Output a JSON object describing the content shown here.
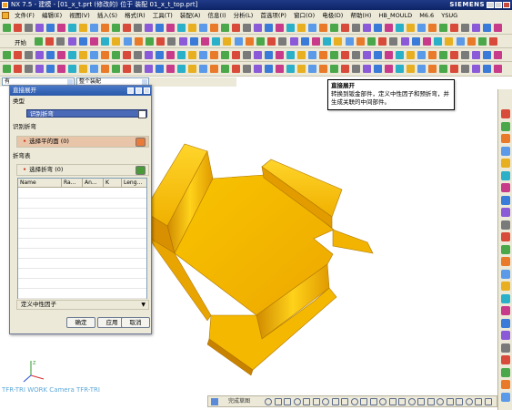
{
  "window": {
    "title": "NX 7.5 - 建模 - [01_x_t.prt (修改的) 位于 装配 01_x_t_top.prt]",
    "brand": "SIEMENS"
  },
  "menu": {
    "items": [
      "文件(F)",
      "编辑(E)",
      "视图(V)",
      "插入(S)",
      "格式(R)",
      "工具(T)",
      "装配(A)",
      "信息(I)",
      "分析(L)",
      "首选项(P)",
      "窗口(O)",
      "电极(D)",
      "帮助(H)",
      "HB_MOULD",
      "M6.6",
      "YSUG"
    ]
  },
  "toolbar": {
    "start_label": "开始",
    "filter_value": "有",
    "scope_value": "整个装配"
  },
  "tooltip": {
    "title": "直接展开",
    "body": "转换到钣金部件，定义中性因子和预折弯，并生成关联的中间部件。"
  },
  "dialog": {
    "title": "直接展开",
    "type_section": "类型",
    "type_value": "识别折弯",
    "identify_section": "识别折弯",
    "select_face": "选择平的面 (0)",
    "bend_table_section": "折弯表",
    "select_bend": "选择折弯 (0)",
    "columns": [
      "Name",
      "Ra...",
      "An...",
      "K",
      "Leng..."
    ],
    "neutral_label": "定义中性因子",
    "ok_label": "确定",
    "apply_label": "应用",
    "cancel_label": "取消"
  },
  "viewport": {
    "view_label": "TFR-TRI WORK Camera TFR-TRI",
    "part_color": "#f5b800",
    "part_edge_color": "#b07800"
  },
  "bottom_bar": {
    "label": "完成草图"
  },
  "colors": {
    "title_bar": "#1a3a8a",
    "dialog_title": "#3a66b8",
    "required_marker": "#d03010",
    "face_highlight": "#e8c4a8"
  }
}
